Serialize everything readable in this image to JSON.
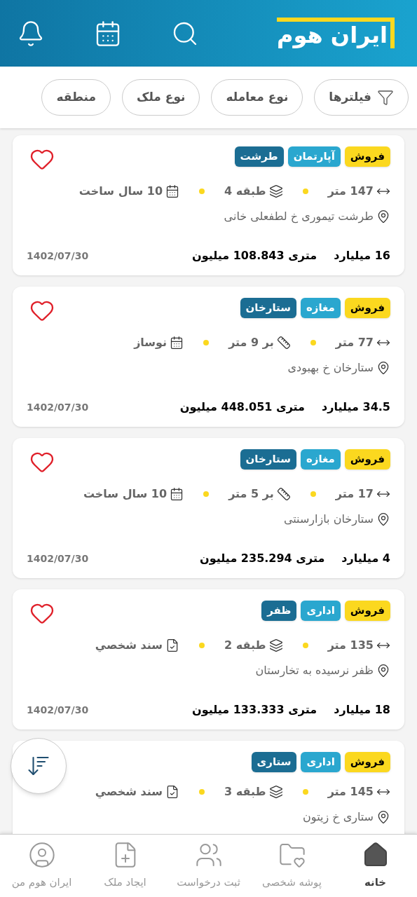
{
  "header": {
    "title": "ایران هوم"
  },
  "filters": [
    {
      "label": "فیلترها",
      "kind": "filter"
    },
    {
      "label": "نوع معامله",
      "kind": "plain"
    },
    {
      "label": "نوع ملک",
      "kind": "plain"
    },
    {
      "label": "منطقه",
      "kind": "plain"
    }
  ],
  "listings": [
    {
      "tags": [
        {
          "label": "فروش",
          "kind": "deal"
        },
        {
          "label": "آپارتمان",
          "kind": "type"
        },
        {
          "label": "طرشت",
          "kind": "area"
        }
      ],
      "favorite": false,
      "features": [
        {
          "kind": "size",
          "text": "147 متر"
        },
        {
          "kind": "floor",
          "text": "طبقه 4"
        },
        {
          "kind": "age",
          "text": "10 سال ساخت"
        }
      ],
      "location": "طرشت تیموری خ لطفعلی خانی",
      "price": "16 میلیارد",
      "price_per_meter": "متری 108.843 میلیون",
      "date": "1402/07/30"
    },
    {
      "tags": [
        {
          "label": "فروش",
          "kind": "deal"
        },
        {
          "label": "مغازه",
          "kind": "type"
        },
        {
          "label": "ستارخان",
          "kind": "area"
        }
      ],
      "favorite": false,
      "features": [
        {
          "kind": "size",
          "text": "77 متر"
        },
        {
          "kind": "width",
          "text": "بر 9 متر"
        },
        {
          "kind": "age",
          "text": "نوساز"
        }
      ],
      "location": "ستارخان خ بهبودی",
      "price": "34.5 میلیارد",
      "price_per_meter": "متری 448.051 میلیون",
      "date": "1402/07/30"
    },
    {
      "tags": [
        {
          "label": "فروش",
          "kind": "deal"
        },
        {
          "label": "مغازه",
          "kind": "type"
        },
        {
          "label": "ستارخان",
          "kind": "area"
        }
      ],
      "favorite": false,
      "features": [
        {
          "kind": "size",
          "text": "17 متر"
        },
        {
          "kind": "width",
          "text": "بر 5 متر"
        },
        {
          "kind": "age",
          "text": "10 سال ساخت"
        }
      ],
      "location": "ستارخان بازارسنتی",
      "price": "4 میلیارد",
      "price_per_meter": "متری 235.294 میلیون",
      "date": "1402/07/30"
    },
    {
      "tags": [
        {
          "label": "فروش",
          "kind": "deal"
        },
        {
          "label": "اداری",
          "kind": "type"
        },
        {
          "label": "ظفر",
          "kind": "area"
        }
      ],
      "favorite": false,
      "features": [
        {
          "kind": "size",
          "text": "135 متر"
        },
        {
          "kind": "floor",
          "text": "طبقه 2"
        },
        {
          "kind": "deed",
          "text": "سند شخصي"
        }
      ],
      "location": "ظفر نرسیده به تخارستان",
      "price": "18 میلیارد",
      "price_per_meter": "متری 133.333 میلیون",
      "date": "1402/07/30"
    },
    {
      "tags": [
        {
          "label": "فروش",
          "kind": "deal"
        },
        {
          "label": "اداری",
          "kind": "type"
        },
        {
          "label": "ستاری",
          "kind": "area"
        }
      ],
      "features": [
        {
          "kind": "size",
          "text": "145 متر"
        },
        {
          "kind": "floor",
          "text": "طبقه 3"
        },
        {
          "kind": "deed",
          "text": "سند شخصي"
        }
      ],
      "location": "ستاری خ زیتون"
    }
  ],
  "nav": [
    {
      "label": "خانه",
      "kind": "home",
      "selected": true
    },
    {
      "label": "پوشه شخصی",
      "kind": "folder",
      "selected": false
    },
    {
      "label": "ثبت درخواست",
      "kind": "request",
      "selected": false
    },
    {
      "label": "ایجاد ملک",
      "kind": "create",
      "selected": false
    },
    {
      "label": "ایران هوم من",
      "kind": "profile",
      "selected": false
    }
  ]
}
